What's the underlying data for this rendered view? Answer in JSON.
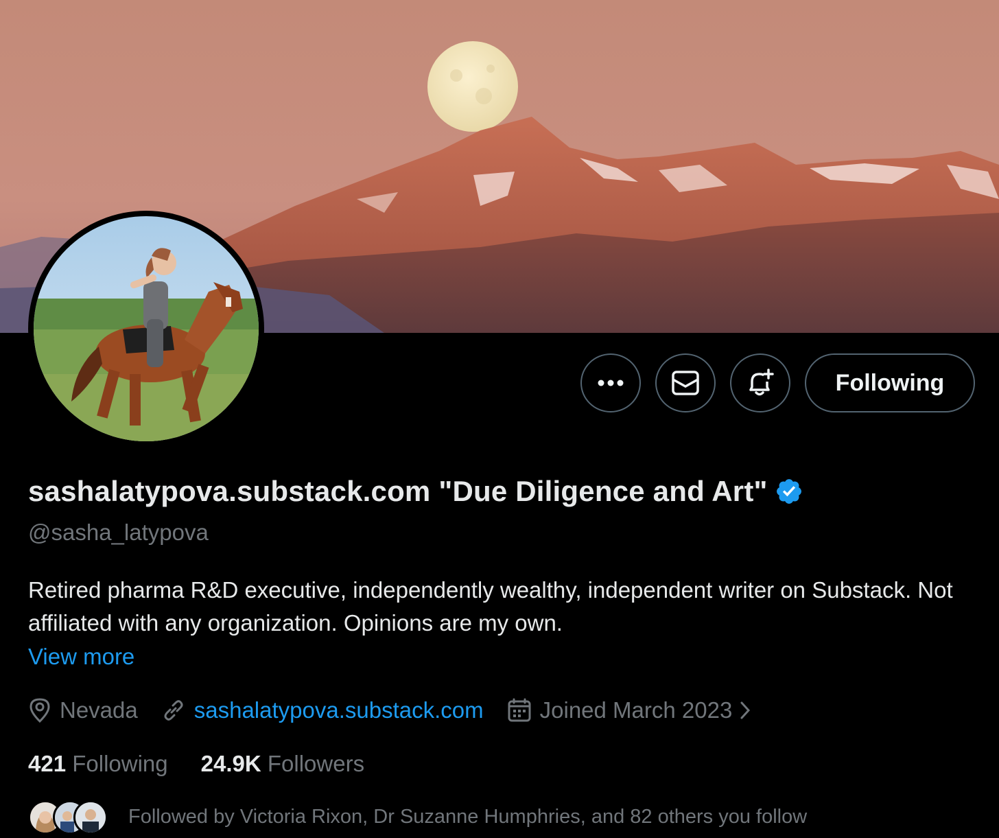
{
  "profile": {
    "display_name": "sashalatypova.substack.com \"Due Diligence and Art\"",
    "handle": "@sasha_latypova",
    "bio": "Retired pharma R&D executive, independently wealthy, independent writer on Substack.  Not affiliated with any organization.  Opinions are my own.",
    "view_more": "View more",
    "location": "Nevada",
    "website": "sashalatypova.substack.com",
    "joined": "Joined March 2023",
    "following_count": "421",
    "following_label": "Following",
    "followers_count": "24.9K",
    "followers_label": "Followers",
    "followed_by": "Followed by Victoria Rixon, Dr Suzanne Humphries, and 82 others you follow"
  },
  "actions": {
    "more_icon": "more-icon",
    "message_icon": "mail-icon",
    "notify_icon": "bell-plus-icon",
    "follow_label": "Following"
  },
  "colors": {
    "background": "#000000",
    "text": "#e7e9ea",
    "muted": "#71767b",
    "link": "#1d9bf0",
    "border": "#536471",
    "verified": "#1d9bf0"
  }
}
